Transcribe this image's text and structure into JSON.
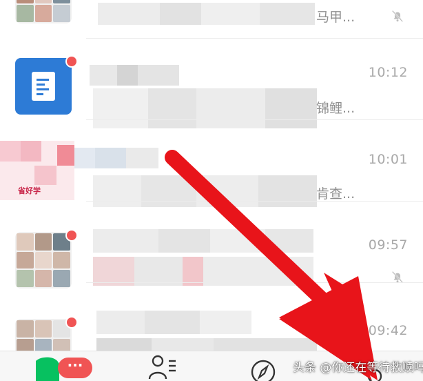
{
  "chats": [
    {
      "id": "chat-1",
      "time": "",
      "preview_tail": "马甲...",
      "muted": true
    },
    {
      "id": "chat-2",
      "time": "10:12",
      "preview_tail": "锦鲤...",
      "muted": false
    },
    {
      "id": "chat-3",
      "time": "10:01",
      "preview_tail": "肯查...",
      "muted": false
    },
    {
      "id": "chat-4",
      "time": "09:57",
      "preview_tail": "",
      "muted": true
    },
    {
      "id": "chat-5",
      "time": "09:42",
      "preview_tail": "",
      "muted": false
    }
  ],
  "avatar_text": {
    "chat_3": "省好学"
  },
  "tabbar": {
    "chats_badge": "···"
  },
  "watermark": "头条 @你还在等待救赎吗",
  "colors": {
    "accent_green": "#07c160",
    "badge_red": "#f05454",
    "arrow_red": "#e8141a",
    "doc_blue": "#2d7bd6"
  },
  "icons": [
    "mute-bell-icon",
    "document-icon",
    "chats-tab-icon",
    "contacts-tab-icon",
    "discover-compass-icon",
    "me-tab-icon"
  ]
}
